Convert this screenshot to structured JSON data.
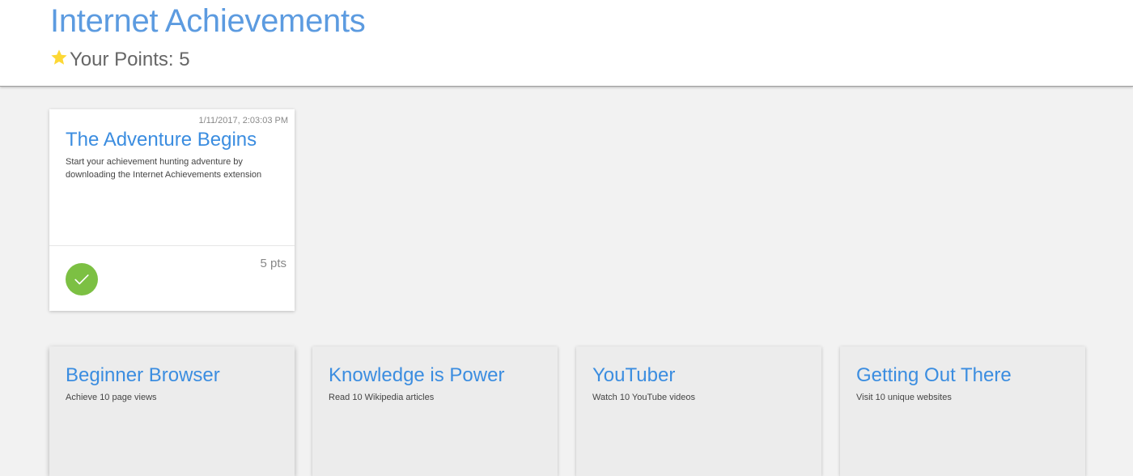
{
  "header": {
    "title": "Internet Achievements",
    "points_label": "Your Points: 5",
    "star_icon": "star-icon",
    "star_color": "#fdd835"
  },
  "unlocked": [
    {
      "date": "1/11/2017, 2:03:03 PM",
      "title": "The Adventure Begins",
      "description": "Start your achievement hunting adventure by downloading the Internet Achievements extension",
      "points": "5 pts",
      "status_icon": "check-icon",
      "status_color": "#7cc043"
    }
  ],
  "locked": [
    {
      "title": "Beginner Browser",
      "description": "Achieve 10 page views"
    },
    {
      "title": "Knowledge is Power",
      "description": "Read 10 Wikipedia articles"
    },
    {
      "title": "YouTuber",
      "description": "Watch 10 YouTube videos"
    },
    {
      "title": "Getting Out There",
      "description": "Visit 10 unique websites"
    }
  ],
  "colors": {
    "accent": "#3b8de0",
    "background": "#f2f2f2",
    "locked_card": "#ececec"
  }
}
